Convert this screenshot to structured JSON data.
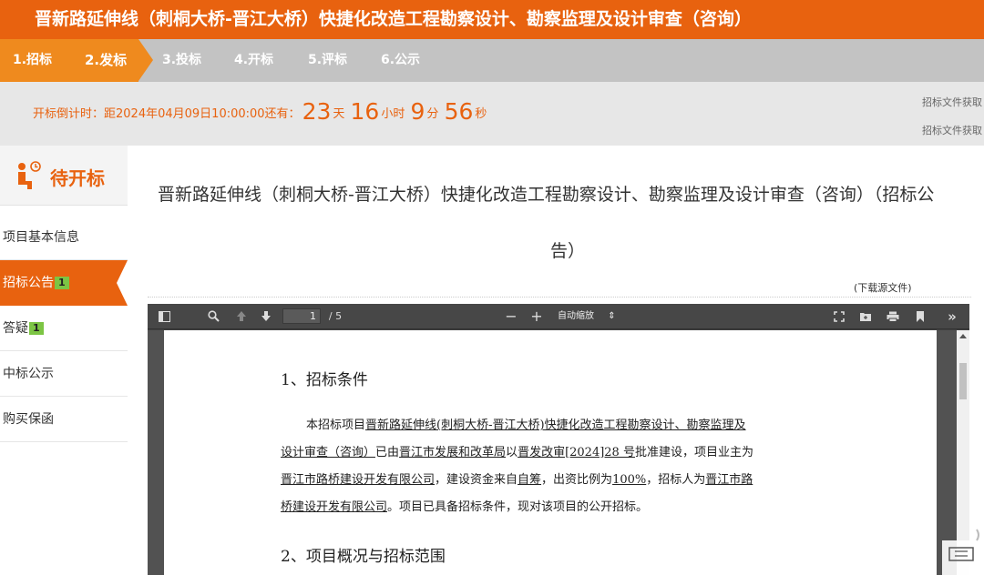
{
  "title": "晋新路延伸线（刺桐大桥-晋江大桥）快捷化改造工程勘察设计、勘察监理及设计审查（咨询）",
  "steps": [
    {
      "label": "1.招标"
    },
    {
      "label": "2.发标"
    },
    {
      "label": "3.投标"
    },
    {
      "label": "4.开标"
    },
    {
      "label": "5.评标"
    },
    {
      "label": "6.公示"
    }
  ],
  "countdown": {
    "prefix": "开标倒计时：距2024年04月09日10:00:00还有：",
    "days": "23",
    "days_unit": "天",
    "hours": "16",
    "hours_unit": "小时",
    "minutes": "9",
    "minutes_unit": "分",
    "seconds": "56",
    "seconds_unit": "秒",
    "side_1": "招标文件获取",
    "side_2": "招标文件获取"
  },
  "sidebar": {
    "header": "待开标",
    "items": [
      {
        "label": "项目基本信息",
        "badge": ""
      },
      {
        "label": "招标公告",
        "badge": "1"
      },
      {
        "label": "答疑",
        "badge": "1"
      },
      {
        "label": "中标公示",
        "badge": ""
      },
      {
        "label": "购买保函",
        "badge": ""
      }
    ]
  },
  "main": {
    "title_line1": "晋新路延伸线（刺桐大桥-晋江大桥）快捷化改造工程勘察设计、勘察监理及设计审查（咨询）（招标公",
    "title_line2": "告）",
    "download": "(下载源文件)"
  },
  "viewer": {
    "page_value": "1",
    "page_total": "/ 5",
    "zoom": "自动缩放",
    "minus": "−",
    "plus": "+",
    "more": "»"
  },
  "doc": {
    "heading1": "1、招标条件",
    "para_lines": [
      [
        "本招标项目",
        "晋新路延伸线(刺桐大桥-晋江大桥)快捷化改造工程勘察设计、勘察监理及"
      ],
      [
        "设计审查（咨询）",
        "已由",
        "晋江市发展和改革局",
        "以",
        "晋发改审[2024]28 号",
        "批准建设，项目业主为"
      ],
      [
        "晋江市路桥建设开发有限公司",
        "，建设资金来自",
        "自筹",
        "，出资比例为",
        "100%",
        "，招标人为",
        "晋江市路"
      ],
      [
        "桥建设开发有限公司",
        "。项目已具备招标条件，现对该项目的公开招标。"
      ]
    ],
    "heading2": "2、项目概况与招标范围"
  },
  "colors": {
    "brand_orange": "#e8620f",
    "step_active": "#ef8a1e",
    "step_inactive": "#c3c3c3",
    "badge_green": "#7cc544",
    "viewer_dark": "#474747"
  }
}
